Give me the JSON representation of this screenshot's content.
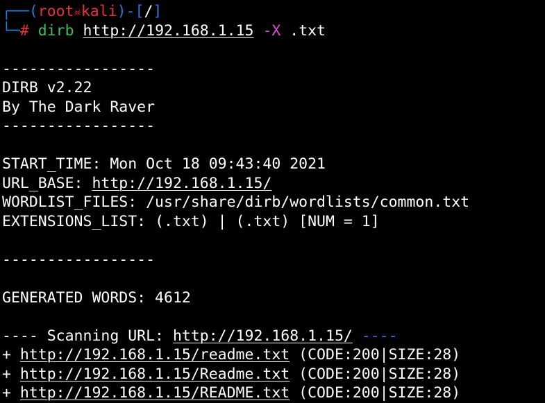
{
  "prompt": {
    "box_top": "┌──(",
    "user": "root",
    "skull": "☠",
    "host": "kali",
    "path_open": ")-[",
    "path": "/",
    "path_close": "]",
    "box_bottom": "└─",
    "hash": "#",
    "command": "dirb",
    "url_arg": "http://192.168.1.15",
    "flag": "-X",
    "ext_arg": ".txt"
  },
  "output": {
    "sep": "-----------------",
    "banner_name": "DIRB v2.22",
    "banner_author": "By The Dark Raver",
    "start_time_label": "START_TIME: ",
    "start_time_value": "Mon Oct 18 09:43:40 2021",
    "url_base_label": "URL_BASE: ",
    "url_base_value": "http://192.168.1.15/",
    "wordlist_label": "WORDLIST_FILES: ",
    "wordlist_value": "/usr/share/dirb/wordlists/common.txt",
    "extensions_label": "EXTENSIONS_LIST: ",
    "extensions_value": "(.txt) | (.txt) [NUM = 1]",
    "generated_words": "GENERATED WORDS: 4612",
    "scanning_prefix": "---- Scanning URL: ",
    "scanning_url": "http://192.168.1.15/",
    "scanning_suffix": "----",
    "results": [
      {
        "plus": "+ ",
        "url": "http://192.168.1.15/readme.txt",
        "info": " (CODE:200|SIZE:28)"
      },
      {
        "plus": "+ ",
        "url": "http://192.168.1.15/Readme.txt",
        "info": " (CODE:200|SIZE:28)"
      },
      {
        "plus": "+ ",
        "url": "http://192.168.1.15/README.txt",
        "info": " (CODE:200|SIZE:28)"
      }
    ]
  },
  "colors": {
    "background": "#000000",
    "text": "#ffffff",
    "prompt_frame": "#2a7bd8",
    "prompt_user": "#e8303a",
    "command": "#3fbf5f",
    "flag": "#e24bd8"
  }
}
